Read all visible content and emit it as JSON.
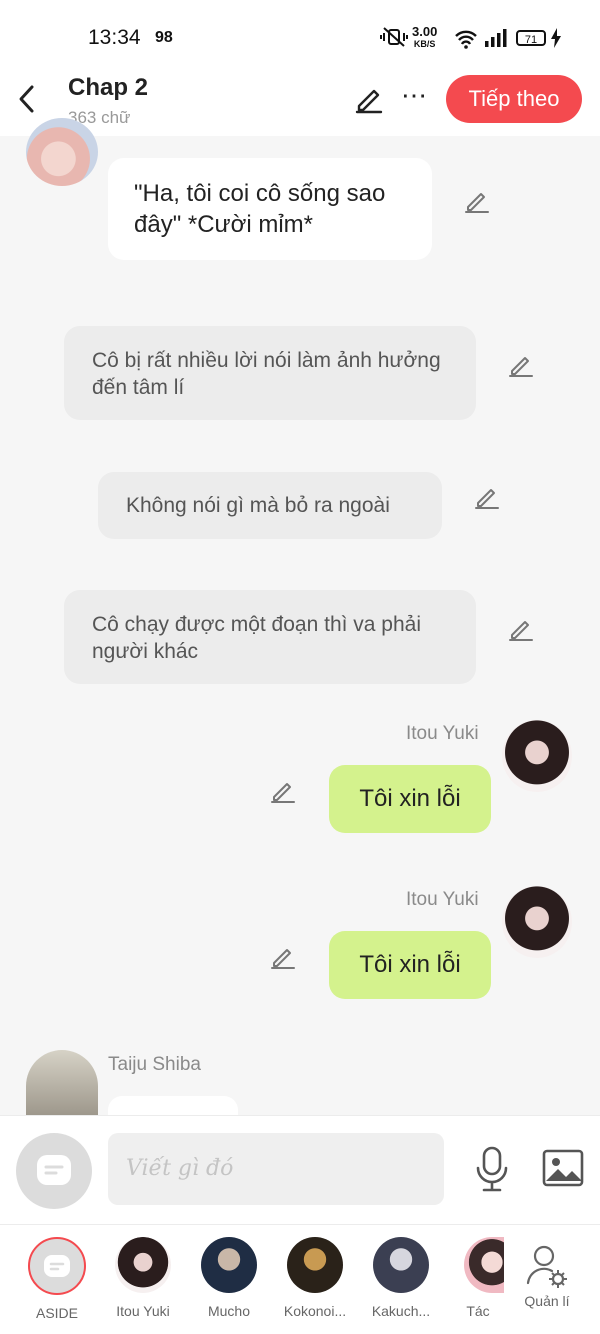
{
  "status_bar": {
    "time": "13:34",
    "notification": "98",
    "net_speed": "3.00",
    "net_unit": "KB/S",
    "battery": "71"
  },
  "header": {
    "title": "Chap 2",
    "word_count": "363 chữ",
    "next_label": "Tiếp theo"
  },
  "messages": [
    {
      "type": "left",
      "text": "\"Ha, tôi coi cô sống sao đây\" *Cười mỉm*"
    },
    {
      "type": "narration",
      "text": "Cô bị rất nhiều lời nói làm ảnh hưởng đến tâm lí"
    },
    {
      "type": "narration",
      "text": "Không nói gì mà bỏ ra ngoài"
    },
    {
      "type": "narration",
      "text": "Cô chạy được một đoạn thì va phải người khác"
    },
    {
      "type": "right",
      "name": "Itou Yuki",
      "text": "Tôi xin lỗi"
    },
    {
      "type": "right",
      "name": "Itou Yuki",
      "text": "Tôi xin lỗi"
    },
    {
      "type": "left",
      "name": "Taiju Shiba",
      "text": ""
    }
  ],
  "composer": {
    "placeholder": "Viết gì đó"
  },
  "nav": [
    {
      "label": "ASIDE"
    },
    {
      "label": "Itou Yuki"
    },
    {
      "label": "Mucho"
    },
    {
      "label": "Kokonoi..."
    },
    {
      "label": "Kakuch..."
    },
    {
      "label": "Tác"
    },
    {
      "label": "Quản lí"
    }
  ],
  "colors": {
    "accent": "#f44a4f",
    "bubble_green": "#d4f28d",
    "narration_bg": "#ececec"
  },
  "icons": [
    "back-icon",
    "edit-icon",
    "more-icon",
    "mic-icon",
    "image-icon",
    "manage-user-icon",
    "aside-icon"
  ]
}
